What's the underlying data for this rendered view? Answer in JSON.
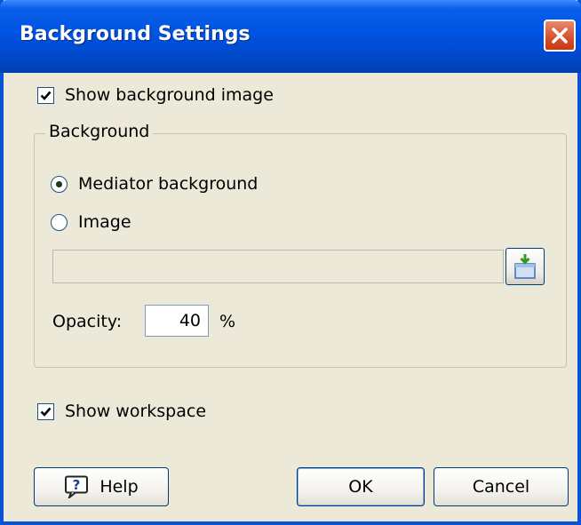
{
  "window": {
    "title": "Background Settings"
  },
  "show_background_image": {
    "label": "Show background image",
    "checked": true
  },
  "background_group": {
    "label": "Background",
    "options": [
      {
        "label": "Mediator background",
        "selected": true
      },
      {
        "label": "Image",
        "selected": false
      }
    ],
    "image_path": "",
    "opacity_label": "Opacity:",
    "opacity_value": "40",
    "opacity_unit": "%"
  },
  "show_workspace": {
    "label": "Show workspace",
    "checked": true
  },
  "buttons": {
    "help": "Help",
    "ok": "OK",
    "cancel": "Cancel"
  },
  "colors": {
    "titlebar": "#0054e3",
    "window_bg": "#ece9d8",
    "close": "#d6502e"
  }
}
